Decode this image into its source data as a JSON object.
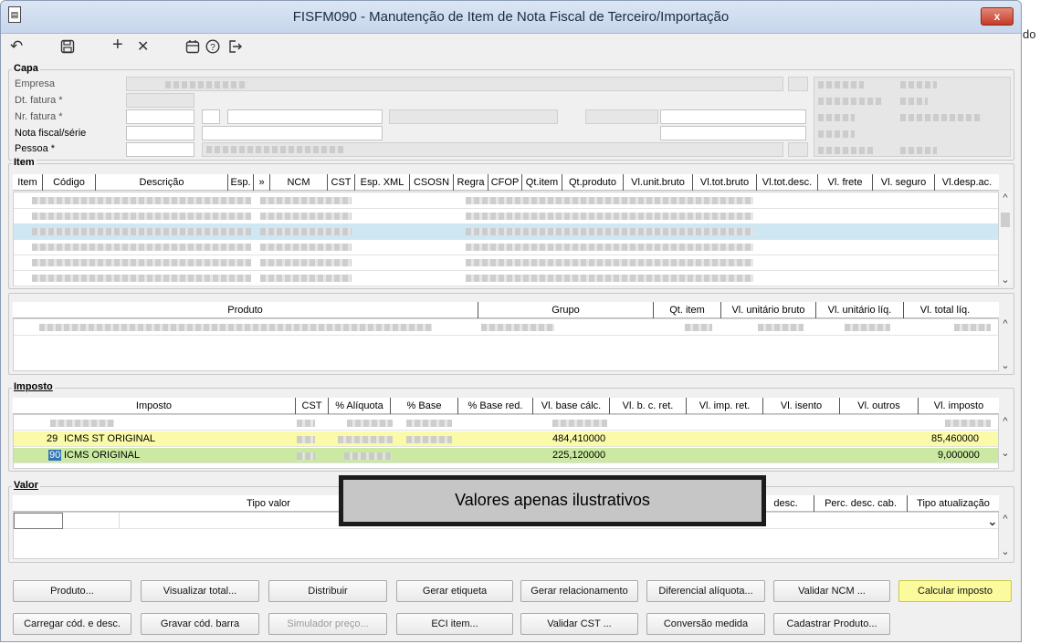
{
  "window": {
    "title": "FISFM090 - Manutenção de Item de Nota Fiscal de Terceiro/Importação",
    "close_label": "x"
  },
  "background_text": "do",
  "toolbar": {
    "icons": [
      "undo-icon",
      "save-icon",
      "add-icon",
      "delete-icon",
      "calendar-icon",
      "help-icon",
      "exit-icon"
    ],
    "glyphs": [
      "↶",
      "💾",
      "+",
      "✕",
      "▣",
      "?",
      "↦"
    ]
  },
  "capa": {
    "title": "Capa",
    "labels": {
      "empresa": "Empresa",
      "dt_fatura": "Dt. fatura *",
      "nr_fatura": "Nr. fatura *",
      "nota_fiscal_serie": "Nota fiscal/série",
      "pessoa": "Pessoa *"
    }
  },
  "item": {
    "title": "Item",
    "columns": [
      "Item",
      "Código",
      "Descrição",
      "Esp.",
      "»",
      "NCM",
      "CST",
      "Esp. XML",
      "CSOSN",
      "Regra",
      "CFOP",
      "Qt.item",
      "Qt.produto",
      "Vl.unit.bruto",
      "Vl.tot.bruto",
      "Vl.tot.desc.",
      "Vl. frete",
      "Vl. seguro",
      "Vl.desp.ac."
    ]
  },
  "produto": {
    "columns": [
      "Produto",
      "Grupo",
      "Qt. item",
      "Vl. unitário bruto",
      "Vl. unitário líq.",
      "Vl. total líq."
    ]
  },
  "imposto": {
    "title": "Imposto",
    "columns": [
      "Imposto",
      "CST",
      "% Alíquota",
      "% Base",
      "% Base red.",
      "Vl. base cálc.",
      "Vl. b. c. ret.",
      "Vl. imp. ret.",
      "Vl. isento",
      "Vl. outros",
      "Vl. imposto"
    ],
    "rows": [
      {
        "code": "29",
        "name": "ICMS ST ORIGINAL",
        "base_calc": "484,410000",
        "imposto": "85,460000"
      },
      {
        "code": "90",
        "name": "ICMS ORIGINAL",
        "base_calc": "225,120000",
        "imposto": "9,000000"
      }
    ]
  },
  "valor": {
    "title": "Valor",
    "columns": [
      "Tipo valor",
      "desc.",
      "Perc. desc. cab.",
      "Tipo atualização"
    ],
    "dropdown_glyph": "⌄"
  },
  "banner": {
    "text": "Valores apenas ilustrativos"
  },
  "buttons_row1": [
    "Produto...",
    "Visualizar total...",
    "Distribuir",
    "Gerar etiqueta",
    "Gerar relacionamento",
    "Diferencial alíquota...",
    "Validar NCM ...",
    "Calcular imposto"
  ],
  "buttons_row2": [
    "Carregar cód. e desc.",
    "Gravar cód. barra",
    "Simulador preço...",
    "ECI item...",
    "Validar CST ...",
    "Conversão medida",
    "Cadastrar Produto..."
  ],
  "colors": {
    "selected_row": "#cfe6f3",
    "yellow_row": "#fafaa8",
    "green_row": "#cbe9a2",
    "highlight_button": "#fbfb9e"
  }
}
